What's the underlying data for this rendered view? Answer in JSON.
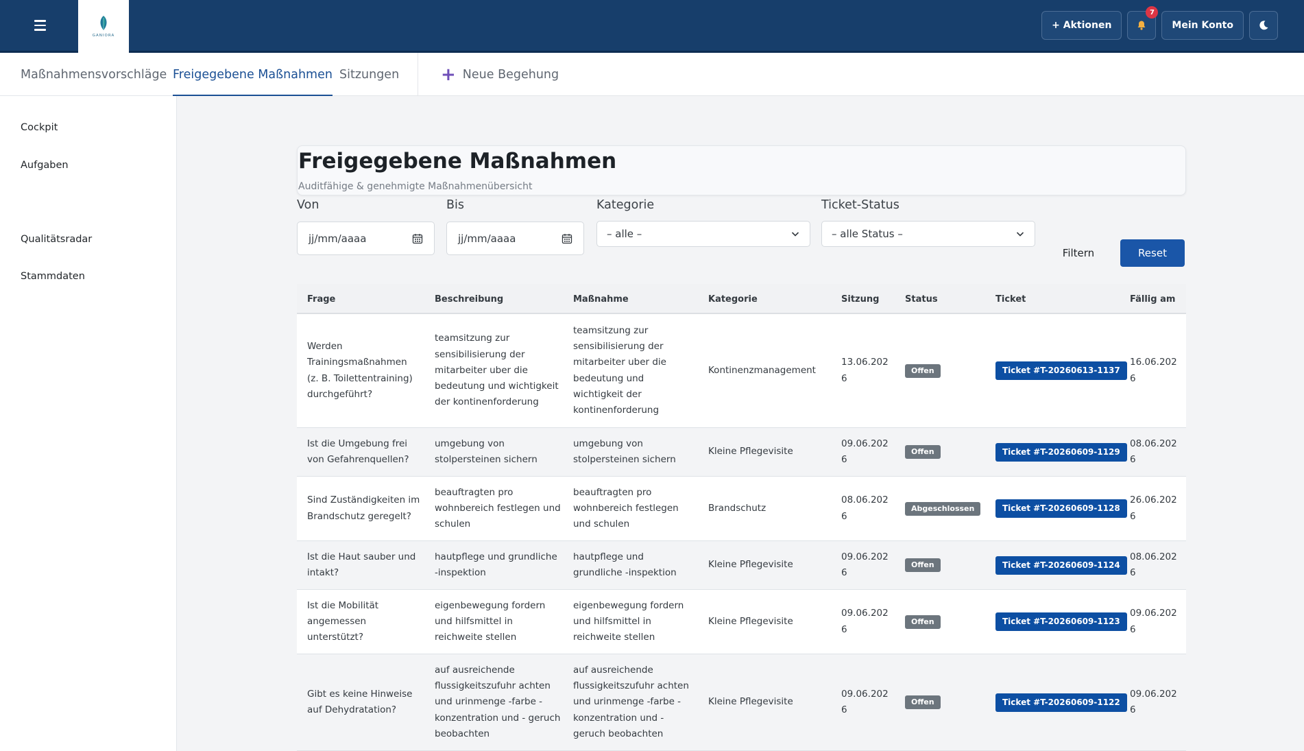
{
  "header": {
    "menu_icon": "hamburger-icon",
    "logo_text": "GANIORA",
    "actions_label": "+ Aktionen",
    "notification_count": "7",
    "account_label": "Mein Konto",
    "theme_icon": "moon-icon",
    "bell_icon": "bell-icon",
    "colors": {
      "navbar": "#173e6b",
      "accent": "#1a56a8",
      "badge": "#dc3545"
    }
  },
  "tabs": [
    {
      "label": "Maßnahmensvorschläge",
      "active": false
    },
    {
      "label": "Freigegebene Maßnahmen",
      "active": true
    },
    {
      "label": "Sitzungen",
      "active": false
    }
  ],
  "new_inspection_label": "Neue Begehung",
  "sidebar": {
    "items": [
      {
        "label": "Cockpit"
      },
      {
        "label": "Aufgaben"
      },
      {
        "label": "Qualitätsradar"
      },
      {
        "label": "Stammdaten"
      }
    ]
  },
  "page": {
    "title": "Freigegebene Maßnahmen",
    "subtitle": "Auditfähige & genehmigte Maßnahmenübersicht"
  },
  "filters": {
    "from_label": "Von",
    "from_placeholder": "jj/mm/aaaa",
    "to_label": "Bis",
    "to_placeholder": "jj/mm/aaaa",
    "category_label": "Kategorie",
    "category_value": "– alle –",
    "ticket_status_label": "Ticket-Status",
    "ticket_status_value": "– alle Status –",
    "filter_button": "Filtern",
    "reset_button": "Reset"
  },
  "table": {
    "columns": [
      "Frage",
      "Beschreibung",
      "Maßnahme",
      "Kategorie",
      "Sitzung",
      "Status",
      "Ticket",
      "Fällig am"
    ],
    "rows": [
      {
        "frage": "Werden Trainingsmaßnahmen (z. B. Toilettentraining) durchgeführt?",
        "beschreibung": "teamsitzung zur sensibilisierung der mitarbeiter uber die bedeutung und wichtigkeit der kontinenforderung",
        "massnahme": "teamsitzung zur sensibilisierung der mitarbeiter uber die bedeutung und wichtigkeit der kontinenforderung",
        "kategorie": "Kontinenzmanagement",
        "sitzung": "13.06.2026",
        "status": "Offen",
        "ticket": "Ticket #T-20260613-1137",
        "faellig": "16.06.2026"
      },
      {
        "frage": "Ist die Umgebung frei von Gefahrenquellen?",
        "beschreibung": "umgebung von stolpersteinen sichern",
        "massnahme": "umgebung von stolpersteinen sichern",
        "kategorie": "Kleine Pflegevisite",
        "sitzung": "09.06.2026",
        "status": "Offen",
        "ticket": "Ticket #T-20260609-1129",
        "faellig": "08.06.2026"
      },
      {
        "frage": "Sind Zuständigkeiten im Brandschutz geregelt?",
        "beschreibung": "beauftragten pro wohnbereich festlegen und schulen",
        "massnahme": "beauftragten pro wohnbereich festlegen und schulen",
        "kategorie": "Brandschutz",
        "sitzung": "08.06.2026",
        "status": "Abgeschlossen",
        "ticket": "Ticket #T-20260609-1128",
        "faellig": "26.06.2026"
      },
      {
        "frage": "Ist die Haut sauber und intakt?",
        "beschreibung": "hautpflege und grundliche -inspektion",
        "massnahme": "hautpflege und grundliche -inspektion",
        "kategorie": "Kleine Pflegevisite",
        "sitzung": "09.06.2026",
        "status": "Offen",
        "ticket": "Ticket #T-20260609-1124",
        "faellig": "08.06.2026"
      },
      {
        "frage": "Ist die Mobilität angemessen unterstützt?",
        "beschreibung": "eigenbewegung fordern und hilfsmittel in reichweite stellen",
        "massnahme": "eigenbewegung fordern und hilfsmittel in reichweite stellen",
        "kategorie": "Kleine Pflegevisite",
        "sitzung": "09.06.2026",
        "status": "Offen",
        "ticket": "Ticket #T-20260609-1123",
        "faellig": "09.06.2026"
      },
      {
        "frage": "Gibt es keine Hinweise auf Dehydratation?",
        "beschreibung": "auf ausreichende flussigkeitszufuhr achten und urinmenge -farbe - konzentration und - geruch beobachten",
        "massnahme": "auf ausreichende flussigkeitszufuhr achten und urinmenge -farbe - konzentration und - geruch beobachten",
        "kategorie": "Kleine Pflegevisite",
        "sitzung": "09.06.2026",
        "status": "Offen",
        "ticket": "Ticket #T-20260609-1122",
        "faellig": "09.06.2026"
      }
    ]
  }
}
